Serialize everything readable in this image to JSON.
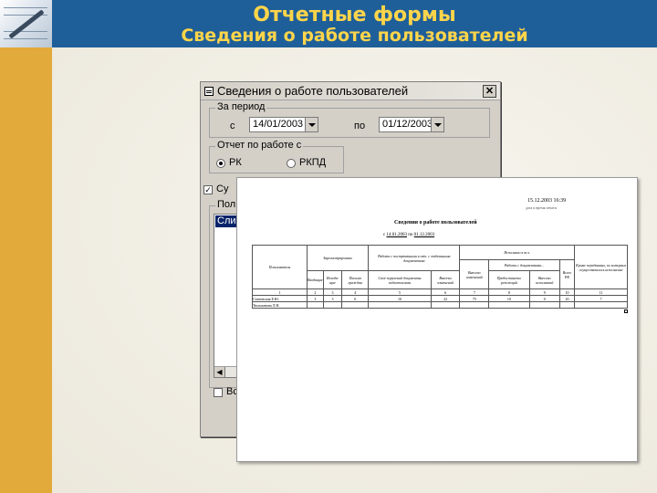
{
  "slide": {
    "title": "Отчетные формы",
    "subtitle": "Сведения о работе пользователей"
  },
  "dialog": {
    "title": "Сведения о работе пользователей",
    "period_group": "За период",
    "from_label": "с",
    "from_value": "14/01/2003",
    "to_label": "по",
    "to_value": "01/12/2003",
    "report_group": "Отчет по работе с",
    "radio_options": [
      {
        "label": "РК",
        "selected": true
      },
      {
        "label": "РКПД",
        "selected": false
      }
    ],
    "checkbox1_label": "Су",
    "users_group": "Польз",
    "list_selected": "Сли",
    "checkbox2_label": "Вс"
  },
  "report": {
    "date": "15.12.2003 16:39",
    "date_caption": "дата и время печати",
    "title": "Сведения о работе пользователей",
    "period_prefix": "с",
    "period_from": "14.01.2003",
    "period_mid": "по",
    "period_to": "01.12.2003",
    "headers": {
      "users": "Пользователь",
      "registered": "Зарегистрировано",
      "registered_sub": [
        "Входящие",
        "Исходя-щие",
        "Письма граждан"
      ],
      "sent": "Работа с поступившими в отч. с отдельными документами",
      "sent_sub": [
        "Своё поручений документы подготовлены",
        "Внесено изменений"
      ],
      "exec_top": "Исполнено в т.ч.",
      "entered": "Внесено изменений",
      "work_group": "Работа с документами...",
      "work_sub": [
        "Предоставлено резолюций",
        "Внесено исполнений"
      ],
      "exec_rf": "Всего РК",
      "other": "Кроме переданных, по которым осуществлялось исполнение"
    },
    "col_numbers": [
      "1",
      "2",
      "3",
      "4",
      "5",
      "6",
      "7",
      "8",
      "9",
      "10",
      "11"
    ],
    "row": {
      "user": "Становская Е.Ю.",
      "values": [
        "3",
        "3",
        "0",
        "10",
        "22",
        "75",
        "10",
        "0",
        "20",
        "7"
      ]
    },
    "row2_user": "Тюльпанова Л.Н."
  }
}
